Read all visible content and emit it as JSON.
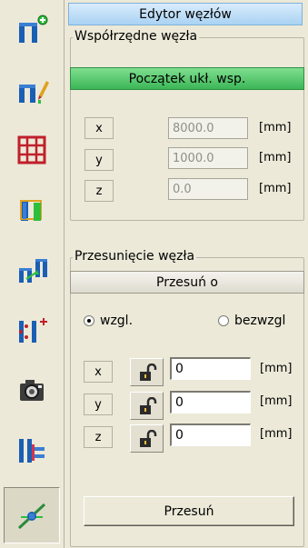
{
  "panel": {
    "title": "Edytor węzłów"
  },
  "coords_group": {
    "legend": "Współrzędne węzła",
    "origin_bar": "Początek ukł. wsp.",
    "rows": [
      {
        "axis": "x",
        "value": "8000.0",
        "unit": "[mm]"
      },
      {
        "axis": "y",
        "value": "1000.0",
        "unit": "[mm]"
      },
      {
        "axis": "z",
        "value": "0.0",
        "unit": "[mm]"
      }
    ]
  },
  "shift_group": {
    "legend": "Przesunięcie węzła",
    "shift_bar": "Przesuń o",
    "radio_relative": "wzgl.",
    "radio_absolute": "bezwzgl",
    "selected_mode": "wzgl.",
    "rows": [
      {
        "axis": "x",
        "value": "0",
        "unit": "[mm]"
      },
      {
        "axis": "y",
        "value": "0",
        "unit": "[mm]"
      },
      {
        "axis": "z",
        "value": "0",
        "unit": "[mm]"
      }
    ],
    "apply_label": "Przesuń"
  },
  "toolbar": {
    "buttons": [
      "add-node-icon",
      "edit-node-icon",
      "grid-icon",
      "node-box-icon",
      "move-node-icon",
      "insert-node-icon",
      "camera-icon",
      "align-node-icon",
      "node-connect-icon"
    ],
    "active_index": 8
  },
  "colors": {
    "title_bar": "#a9d2f3",
    "origin_bar": "#3cb657",
    "icon_blue": "#1a5fb4",
    "accent_green": "#2dbf3c"
  }
}
